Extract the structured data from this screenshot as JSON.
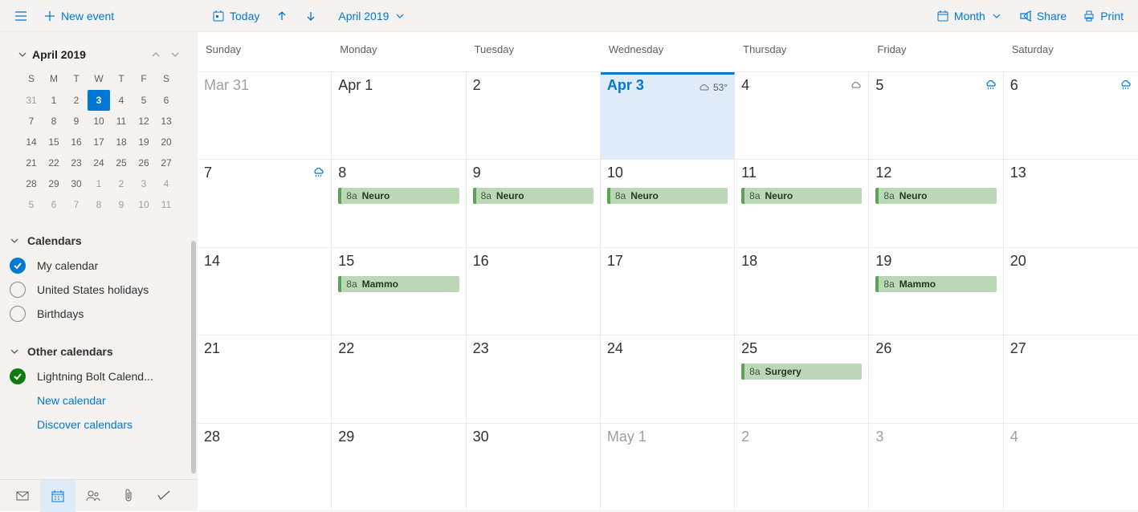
{
  "toolbar": {
    "new_event": "New event",
    "today": "Today",
    "period": "April 2019",
    "view": "Month",
    "share": "Share",
    "print": "Print"
  },
  "mini": {
    "title": "April 2019",
    "weekdays": [
      "S",
      "M",
      "T",
      "W",
      "T",
      "F",
      "S"
    ],
    "days": [
      {
        "n": "31",
        "out": true
      },
      {
        "n": "1"
      },
      {
        "n": "2"
      },
      {
        "n": "3",
        "sel": true
      },
      {
        "n": "4"
      },
      {
        "n": "5"
      },
      {
        "n": "6"
      },
      {
        "n": "7"
      },
      {
        "n": "8"
      },
      {
        "n": "9"
      },
      {
        "n": "10"
      },
      {
        "n": "11"
      },
      {
        "n": "12"
      },
      {
        "n": "13"
      },
      {
        "n": "14"
      },
      {
        "n": "15"
      },
      {
        "n": "16"
      },
      {
        "n": "17"
      },
      {
        "n": "18"
      },
      {
        "n": "19"
      },
      {
        "n": "20"
      },
      {
        "n": "21"
      },
      {
        "n": "22"
      },
      {
        "n": "23"
      },
      {
        "n": "24"
      },
      {
        "n": "25"
      },
      {
        "n": "26"
      },
      {
        "n": "27"
      },
      {
        "n": "28"
      },
      {
        "n": "29"
      },
      {
        "n": "30"
      },
      {
        "n": "1",
        "out": true
      },
      {
        "n": "2",
        "out": true
      },
      {
        "n": "3",
        "out": true
      },
      {
        "n": "4",
        "out": true
      },
      {
        "n": "5",
        "out": true
      },
      {
        "n": "6",
        "out": true
      },
      {
        "n": "7",
        "out": true
      },
      {
        "n": "8",
        "out": true
      },
      {
        "n": "9",
        "out": true
      },
      {
        "n": "10",
        "out": true
      },
      {
        "n": "11",
        "out": true
      }
    ]
  },
  "sidebar": {
    "sections": {
      "calendars": "Calendars",
      "other": "Other calendars"
    },
    "calendars": [
      {
        "name": "My calendar",
        "checked": true,
        "color": "blue"
      },
      {
        "name": "United States holidays",
        "checked": false
      },
      {
        "name": "Birthdays",
        "checked": false
      }
    ],
    "other": [
      {
        "name": "Lightning Bolt Calend...",
        "checked": true,
        "color": "green"
      }
    ],
    "links": {
      "new_calendar": "New calendar",
      "discover": "Discover calendars"
    }
  },
  "grid": {
    "weekdays": [
      "Sunday",
      "Monday",
      "Tuesday",
      "Wednesday",
      "Thursday",
      "Friday",
      "Saturday"
    ],
    "cells": [
      {
        "label": "Mar 31",
        "out": true
      },
      {
        "label": "Apr 1"
      },
      {
        "label": "2"
      },
      {
        "label": "Apr 3",
        "today": true,
        "weather": {
          "temp": "53°",
          "icon": "cloud"
        }
      },
      {
        "label": "4",
        "weather": {
          "icon": "cloud"
        }
      },
      {
        "label": "5",
        "weather": {
          "icon": "rain"
        }
      },
      {
        "label": "6",
        "weather": {
          "icon": "rain"
        }
      },
      {
        "label": "7",
        "weather": {
          "icon": "rain"
        }
      },
      {
        "label": "8",
        "events": [
          {
            "time": "8a",
            "title": "Neuro"
          }
        ]
      },
      {
        "label": "9",
        "events": [
          {
            "time": "8a",
            "title": "Neuro"
          }
        ]
      },
      {
        "label": "10",
        "events": [
          {
            "time": "8a",
            "title": "Neuro"
          }
        ]
      },
      {
        "label": "11",
        "events": [
          {
            "time": "8a",
            "title": "Neuro"
          }
        ]
      },
      {
        "label": "12",
        "events": [
          {
            "time": "8a",
            "title": "Neuro"
          }
        ]
      },
      {
        "label": "13"
      },
      {
        "label": "14"
      },
      {
        "label": "15",
        "events": [
          {
            "time": "8a",
            "title": "Mammo"
          }
        ]
      },
      {
        "label": "16"
      },
      {
        "label": "17"
      },
      {
        "label": "18"
      },
      {
        "label": "19",
        "events": [
          {
            "time": "8a",
            "title": "Mammo"
          }
        ]
      },
      {
        "label": "20"
      },
      {
        "label": "21"
      },
      {
        "label": "22"
      },
      {
        "label": "23"
      },
      {
        "label": "24"
      },
      {
        "label": "25",
        "events": [
          {
            "time": "8a",
            "title": "Surgery"
          }
        ]
      },
      {
        "label": "26"
      },
      {
        "label": "27"
      },
      {
        "label": "28"
      },
      {
        "label": "29"
      },
      {
        "label": "30"
      },
      {
        "label": "May 1",
        "out": true
      },
      {
        "label": "2",
        "out": true
      },
      {
        "label": "3",
        "out": true
      },
      {
        "label": "4",
        "out": true
      }
    ]
  }
}
